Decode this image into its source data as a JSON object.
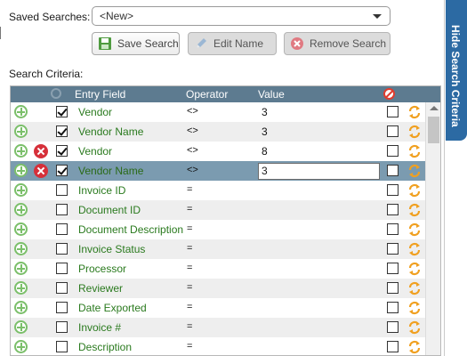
{
  "saved_searches": {
    "label": "Saved Searches:",
    "selected": "<New>"
  },
  "buttons": {
    "save": "Save Search",
    "edit": "Edit Name",
    "remove": "Remove Search"
  },
  "criteria": {
    "label": "Search Criteria:",
    "headers": {
      "entry_field": "Entry Field",
      "operator": "Operator",
      "value": "Value"
    },
    "rows": [
      {
        "field": "Vendor",
        "operator": "<>",
        "value": "3",
        "checked": true,
        "deletable": false,
        "selected": false
      },
      {
        "field": "Vendor Name",
        "operator": "<>",
        "value": "3",
        "checked": true,
        "deletable": false,
        "selected": false
      },
      {
        "field": "Vendor",
        "operator": "<>",
        "value": "8",
        "checked": true,
        "deletable": true,
        "selected": false
      },
      {
        "field": "Vendor Name",
        "operator": "<>",
        "value": "3",
        "checked": true,
        "deletable": true,
        "selected": true
      },
      {
        "field": "Invoice ID",
        "operator": "=",
        "value": "",
        "checked": false,
        "deletable": false,
        "selected": false
      },
      {
        "field": "Document ID",
        "operator": "=",
        "value": "",
        "checked": false,
        "deletable": false,
        "selected": false
      },
      {
        "field": "Document Description",
        "operator": "=",
        "value": "",
        "checked": false,
        "deletable": false,
        "selected": false
      },
      {
        "field": "Invoice Status",
        "operator": "=",
        "value": "",
        "checked": false,
        "deletable": false,
        "selected": false
      },
      {
        "field": "Processor",
        "operator": "=",
        "value": "",
        "checked": false,
        "deletable": false,
        "selected": false
      },
      {
        "field": "Reviewer",
        "operator": "=",
        "value": "",
        "checked": false,
        "deletable": false,
        "selected": false
      },
      {
        "field": "Date Exported",
        "operator": "=",
        "value": "",
        "checked": false,
        "deletable": false,
        "selected": false
      },
      {
        "field": "Invoice #",
        "operator": "=",
        "value": "",
        "checked": false,
        "deletable": false,
        "selected": false
      },
      {
        "field": "Description",
        "operator": "=",
        "value": "",
        "checked": false,
        "deletable": false,
        "selected": false
      }
    ]
  },
  "side_tab": {
    "label": "Hide Search Criteria"
  },
  "colors": {
    "header_bg": "#5d7b90",
    "selected_row": "#7b9bb0",
    "field_text": "#2a7a1e",
    "tab_blue": "#2c6aa3"
  }
}
